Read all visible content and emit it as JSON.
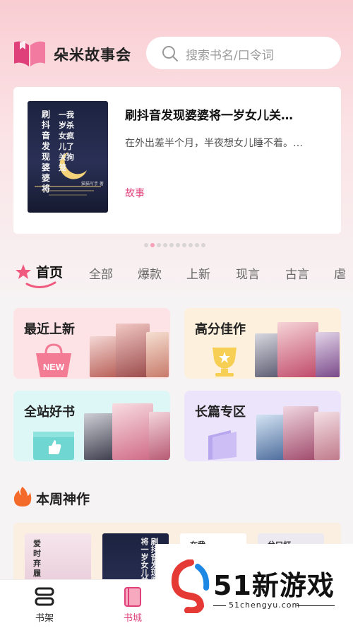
{
  "app": {
    "name": "朵米故事会"
  },
  "search": {
    "placeholder": "搜索书名/口令词"
  },
  "featured": {
    "title": "刷抖音发现婆婆将一岁女儿关…",
    "description": "在外出差半个月，半夜想女儿睡不着。…",
    "tag": "故事",
    "cover_text_col1": "刷抖音发现婆婆将",
    "cover_text_col2": "一我岁杀女疯儿了关狗笼",
    "cover_author": "猫猫写手 著"
  },
  "carousel": {
    "count": 10,
    "active_index": 1
  },
  "tabs": [
    "首页",
    "全部",
    "爆款",
    "上新",
    "现言",
    "古言",
    "虐"
  ],
  "categories": [
    {
      "label": "最近上新",
      "badge": "NEW",
      "color": "#fde2e6"
    },
    {
      "label": "高分佳作",
      "color": "#fdf0dc"
    },
    {
      "label": "全站好书",
      "color": "#ddf6f6"
    },
    {
      "label": "长篇专区",
      "color": "#ebe4fb"
    }
  ],
  "section": {
    "title": "本周神作"
  },
  "weekly_covers": [
    {
      "text": "爱时弃履"
    },
    {
      "text": "刷抖音发现婆婆将一岁女儿关"
    },
    {
      "text": "在我"
    },
    {
      "text": "兮口灯"
    }
  ],
  "nav": {
    "shelf": "书架",
    "store": "书城"
  },
  "watermark": {
    "text": "51新游戏",
    "url": "51chengyu.com"
  },
  "colors": {
    "accent": "#e0407a",
    "logo": "#e0407a"
  }
}
